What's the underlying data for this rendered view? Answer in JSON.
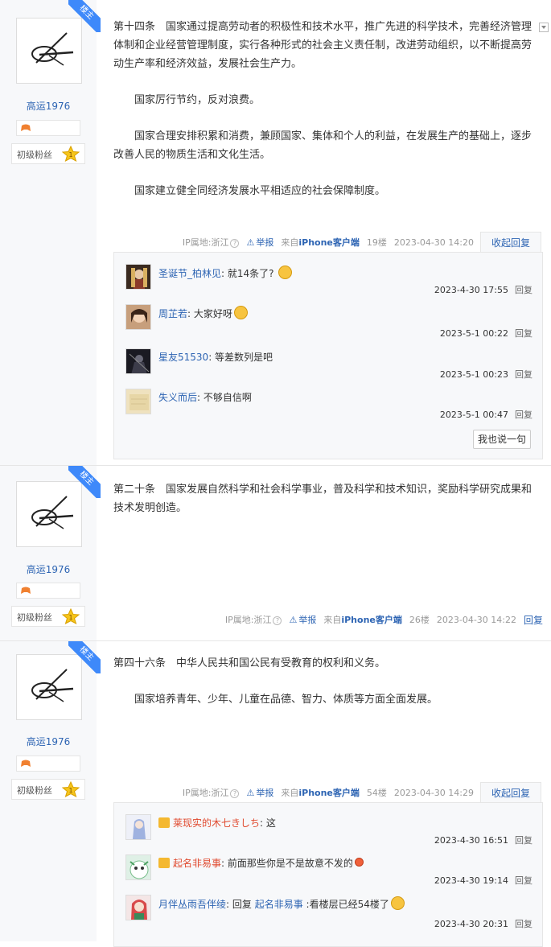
{
  "posts": [
    {
      "author": {
        "name": "高运1976",
        "level_title": "初级粉丝",
        "level_num": "1",
        "host_badge": "楼主"
      },
      "paragraphs": [
        "第十四条　国家通过提高劳动者的积极性和技术水平，推广先进的科学技术，完善经济管理体制和企业经营管理制度，实行各种形式的社会主义责任制，改进劳动组织，以不断提高劳动生产率和经济效益，发展社会生产力。",
        "国家厉行节约，反对浪费。",
        "国家合理安排积累和消费，兼顾国家、集体和个人的利益，在发展生产的基础上，逐步改善人民的物质生活和文化生活。",
        "国家建立健全同经济发展水平相适应的社会保障制度。"
      ],
      "meta": {
        "ip": "IP属地:浙江",
        "report": "举报",
        "client_prefix": "来自",
        "client": "iPhone客户端",
        "floor": "19楼",
        "time": "2023-04-30 14:20",
        "action": "收起回复"
      },
      "comments": [
        {
          "user": "圣诞节_柏林见",
          "text": ": 就14条了?",
          "time": "2023-4-30 17:55",
          "reply": "回复"
        },
        {
          "user": "周芷若",
          "text": ": 大家好呀",
          "time": "2023-5-1 00:22",
          "reply": "回复"
        },
        {
          "user": "星友51530",
          "text": ": 等差数列是吧",
          "time": "2023-5-1 00:23",
          "reply": "回复"
        },
        {
          "user": "失义而后",
          "text": ": 不够自信啊",
          "time": "2023-5-1 00:47",
          "reply": "回复"
        }
      ],
      "say_button": "我也说一句"
    },
    {
      "author": {
        "name": "高运1976",
        "level_title": "初级粉丝",
        "level_num": "1",
        "host_badge": "楼主"
      },
      "paragraphs": [
        "第二十条　国家发展自然科学和社会科学事业，普及科学和技术知识，奖励科学研究成果和技术发明创造。"
      ],
      "meta": {
        "ip": "IP属地:浙江",
        "report": "举报",
        "client_prefix": "来自",
        "client": "iPhone客户端",
        "floor": "26楼",
        "time": "2023-04-30 14:22",
        "action": "回复"
      }
    },
    {
      "author": {
        "name": "高运1976",
        "level_title": "初级粉丝",
        "level_num": "1",
        "host_badge": "楼主"
      },
      "paragraphs": [
        "第四十六条　中华人民共和国公民有受教育的权利和义务。",
        "国家培养青年、少年、儿童在品德、智力、体质等方面全面发展。"
      ],
      "meta": {
        "ip": "IP属地:浙江",
        "report": "举报",
        "client_prefix": "来自",
        "client": "iPhone客户端",
        "floor": "54楼",
        "time": "2023-04-30 14:29",
        "action": "收起回复"
      },
      "comments": [
        {
          "user": "莱现实的木七きしち",
          "text": ": 这",
          "time": "2023-4-30 16:51",
          "reply": "回复"
        },
        {
          "user": "起名非易事",
          "text": ": 前面那些你是不是故意不发的",
          "time": "2023-4-30 19:14",
          "reply": "回复"
        },
        {
          "user": "月伴丛雨吾伴绫",
          "text": ": 回复 ",
          "reply_to": "起名非易事",
          "text2": " :看楼层已经54楼了",
          "time": "2023-4-30 20:31",
          "reply": "回复"
        }
      ]
    }
  ]
}
